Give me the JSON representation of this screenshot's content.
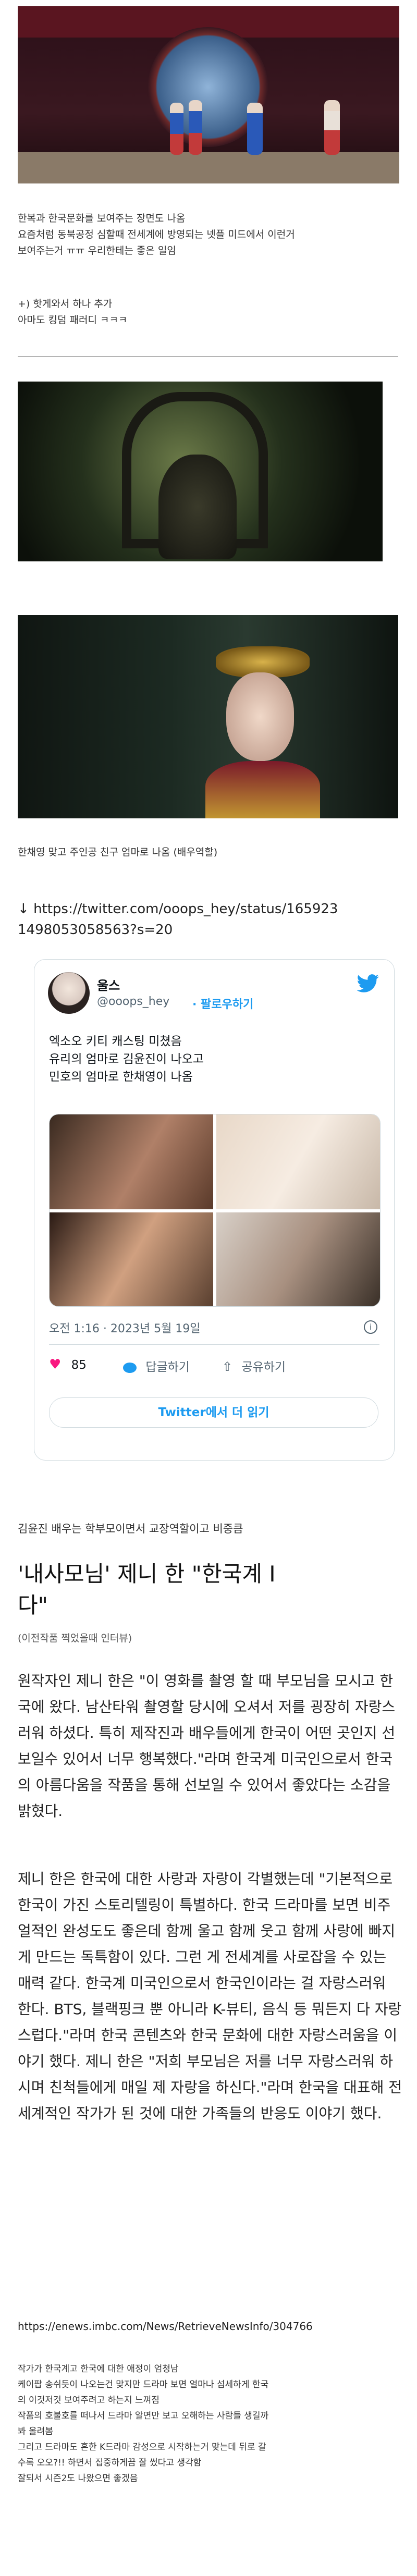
{
  "post": {
    "caption1_line1": "한복과 한국문화를 보여주는 장면도 나옴",
    "caption1_line2": "요즘처럼 동북공정 심할때 전세계에 방영되는 넷플 미드에서 이런거",
    "caption1_line3": "보여주는거 ㅠㅠ 우리한테는 좋은 일임",
    "caption2_line1": "+) 핫게와서 하나 추가",
    "caption2_line2": "아마도 킹덤 패러디 ㅋㅋㅋ",
    "caption3": "한채영 맞고 주인공 친구 엄마로 나옴 (배우역할)",
    "link_arrow": "↓",
    "link_line1": "https://twitter.com/ooops_hey/status/165923",
    "link_line2": "1498053058563?s=20"
  },
  "tweet": {
    "name": "울스",
    "handle": "@ooops_hey",
    "follow_label": "· 팔로우하기",
    "body": "엑소오 키티 캐스팅 미쳤음\n유리의 엄마로 김윤진이 나오고\n민호의 엄마로 한채영이 나옴",
    "timestamp": "오전 1:16 · 2023년 5월 19일",
    "like_count": "85",
    "reply_label": "답글하기",
    "share_label": "공유하기",
    "read_more": "Twitter에서 더 읽기"
  },
  "article": {
    "intro": "김윤진 배우는 학부모이면서 교장역할이고 비중큼",
    "headline": "'내사모님' 제니 한 \"한국계 I",
    "headline2": "다\"",
    "source_note": "(이전작품 찍었을때 인터뷰)",
    "para1": "원작자인 제니 한은 \"이 영화를 촬영 할 때 부모님을 모시고 한국에 왔다. 남산타워 촬영할 당시에 오셔서 저를 굉장히 자랑스러워 하셨다. 특히 제작진과 배우들에게 한국이 어떤 곳인지 선보일수 있어서 너무 행복했다.\"라며 한국계 미국인으로서 한국의 아름다움을 작품을 통해 선보일 수 있어서 좋았다는 소감을 밝혔다.",
    "para2": "제니 한은 한국에 대한 사랑과 자랑이 각별했는데 \"기본적으로 한국이 가진 스토리텔링이 특별하다. 한국 드라마를 보면 비주얼적인 완성도도 좋은데 함께 울고 함께 웃고 함께 사랑에 빠지게 만드는 독특함이 있다. 그런 게 전세계를 사로잡을 수 있는 매력 같다. 한국계 미국인으로서 한국인이라는 걸 자랑스러워 한다. BTS, 블랙핑크 뿐 아니라 K-뷰티, 음식 등 뭐든지 다 자랑스럽다.\"라며 한국 콘텐츠와 한국 문화에 대한 자랑스러움을 이야기 했다. 제니 한은 \"저희 부모님은 저를 너무 자랑스러워 하시며 친척들에게 매일 제 자랑을 하신다.\"라며 한국을 대표해 전세계적인 작가가 된 것에 대한 가족들의 반응도 이야기 했다.",
    "url": "https://enews.imbc.com/News/RetrieveNewsInfo/304766",
    "outro1": "작가가 한국계고 한국에 대한 애정이 엄청남",
    "outro2": "케이팝 송쉬듯이 나오는건 맞지만 드라마 보면 얼마나 섬세하게 한국",
    "outro3": "의 이것저것 보여주려고 하는지 느껴짐",
    "outro4": "작품의 호불호를 떠나서 드라마 알면만 보고 오해하는 사람들 생길까",
    "outro5": "봐 올려봄",
    "outro6": "그리고 드라마도 흔한 K드라마 감성으로 시작하는거 맞는데 뒤로 갈",
    "outro7": "수록 오오?!! 하면서 집중하게끔 잘 썼다고 생각함",
    "outro8": "잘되서 시즌2도 나왔으면 좋겠음"
  },
  "colors": {
    "twitter_blue": "#1d9bf0",
    "like_red": "#f91880"
  }
}
